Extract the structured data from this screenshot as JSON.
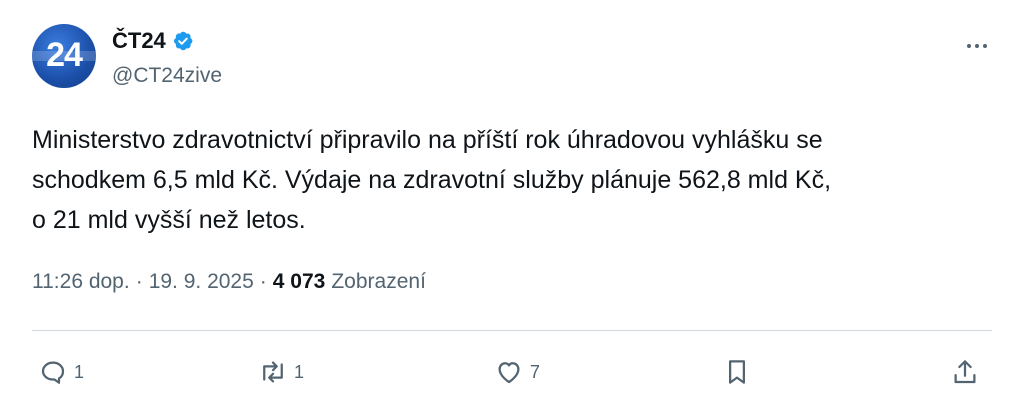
{
  "account": {
    "display_name": "ČT24",
    "handle": "@CT24zive",
    "avatar_text": "24",
    "verified_icon": "verified-badge-icon"
  },
  "tweet": {
    "text": "Ministerstvo zdravotnictví připravilo na příští rok úhradovou vyhlášku se\nschodkem 6,5 mld Kč. Výdaje na zdravotní služby plánuje 562,8 mld Kč,\no 21 mld vyšší než letos."
  },
  "meta": {
    "time": "11:26 dop.",
    "separator": "·",
    "date": "19. 9. 2025",
    "views_count": "4 073",
    "views_label": "Zobrazení"
  },
  "actions": {
    "replies": "1",
    "retweets": "1",
    "likes": "7"
  },
  "colors": {
    "verified": "#1d9bf0",
    "muted": "#536471",
    "text": "#0f1419",
    "divider": "#cfd9de"
  }
}
